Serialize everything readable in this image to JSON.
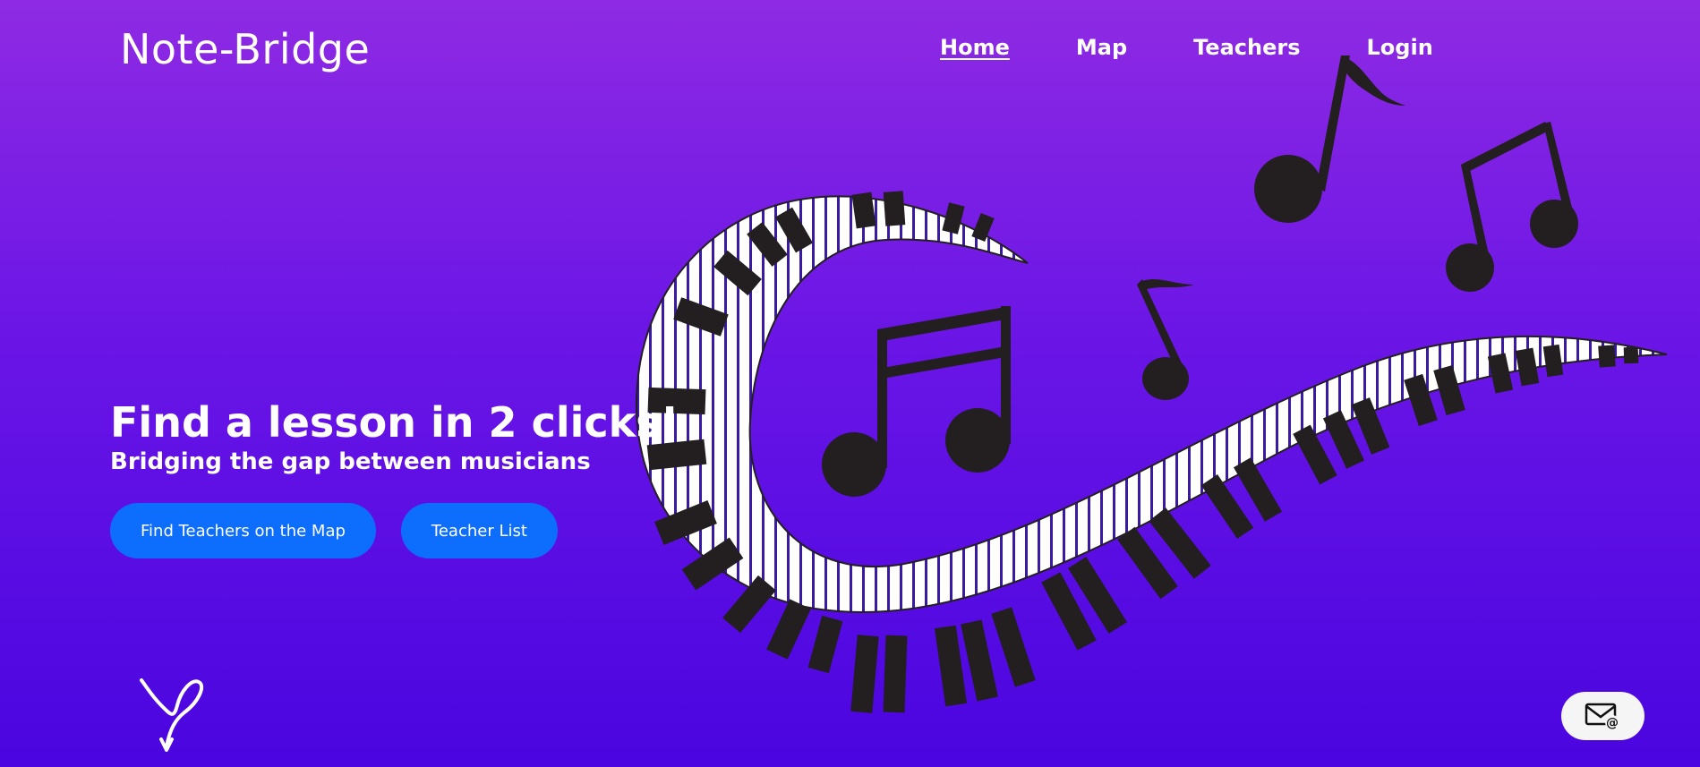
{
  "header": {
    "brand": "Note-Bridge",
    "nav": [
      {
        "label": "Home",
        "active": true
      },
      {
        "label": "Map",
        "active": false
      },
      {
        "label": "Teachers",
        "active": false
      },
      {
        "label": "Login",
        "active": false
      }
    ]
  },
  "hero": {
    "title": "Find a lesson in 2 clicks!",
    "subtitle": "Bridging the gap between musicians",
    "primary_button": "Find Teachers on the Map",
    "secondary_button": "Teacher List"
  },
  "icons": {
    "signature": "signature-logo-icon",
    "mail": "mail-at-icon",
    "illustration": "piano-keyboard-wave-with-music-notes"
  },
  "colors": {
    "background_top": "#8e2ae3",
    "background_bottom": "#4a05e0",
    "button": "#0d6efd",
    "notes": "#231f20"
  }
}
